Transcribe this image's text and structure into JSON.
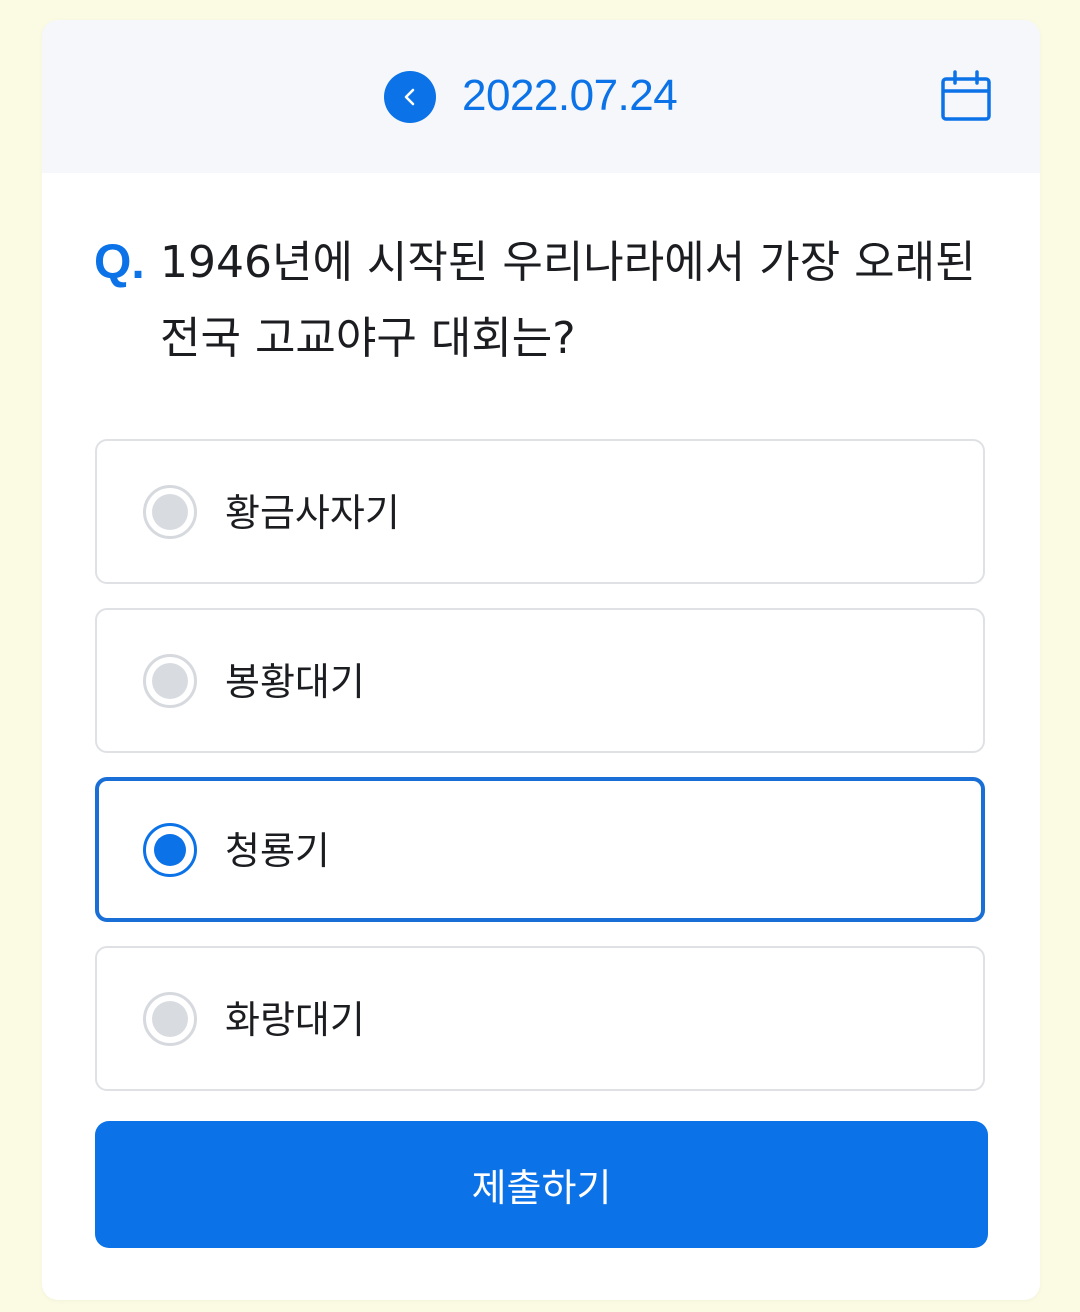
{
  "header": {
    "date": "2022.07.24",
    "back_icon": "chevron-left-icon",
    "calendar_icon": "calendar-icon"
  },
  "question": {
    "prefix": "Q.",
    "text": "1946년에 시작된 우리나라에서 가장 오래된 전국 고교야구 대회는?"
  },
  "options": [
    {
      "label": "황금사자기",
      "selected": false
    },
    {
      "label": "봉황대기",
      "selected": false
    },
    {
      "label": "청룡기",
      "selected": true
    },
    {
      "label": "화랑대기",
      "selected": false
    }
  ],
  "submit_label": "제출하기",
  "colors": {
    "accent": "#0b72e7",
    "background": "#fbfbe3",
    "header_bg": "#f5f7fa",
    "text": "#1c1d21"
  }
}
